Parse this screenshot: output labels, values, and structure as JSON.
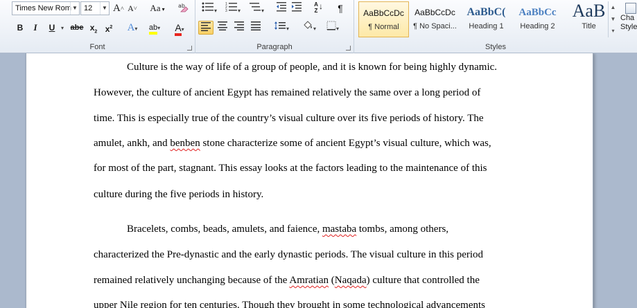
{
  "font": {
    "face_value": "Times New Rom",
    "size_value": "12",
    "grow_label": "A",
    "shrink_label": "A",
    "case_label": "Aa",
    "bold": "B",
    "italic": "I",
    "underline": "U",
    "strike": "abe",
    "subscript": "x",
    "superscript": "x",
    "effects": "A",
    "highlight": "ab",
    "color": "A",
    "group_label": "Font"
  },
  "paragraph": {
    "sort": "A Z",
    "pilcrow": "¶",
    "group_label": "Paragraph"
  },
  "styles": {
    "items": [
      {
        "sample": "AaBbCcDc",
        "name": "¶ Normal"
      },
      {
        "sample": "AaBbCcDc",
        "name": "¶ No Spaci..."
      },
      {
        "sample": "AaBbC(",
        "name": "Heading 1"
      },
      {
        "sample": "AaBbCc",
        "name": "Heading 2"
      },
      {
        "sample": "AaB",
        "name": "Title"
      }
    ],
    "change_label": "Cha Style",
    "group_label": "Styles"
  },
  "document": {
    "p1": [
      "Culture is the way of life of a group of people, and it is known for being highly dynamic.",
      "However, the culture of ancient Egypt has remained relatively the same over a long period of",
      "time. This is especially true of the country’s visual culture over its five periods of history. The",
      [
        "amulet, ankh, and ",
        "benben",
        " stone characterize some of ancient Egypt’s visual culture, which was,"
      ],
      "for most of the part, stagnant. This essay looks at the factors leading to the maintenance of this",
      "culture during the five periods in history."
    ],
    "p2": [
      [
        "Bracelets, combs, beads, amulets, and faience, ",
        "mastaba",
        " tombs, among others,"
      ],
      "characterized the Pre-dynastic and the early dynastic periods. The visual culture in this period",
      [
        "remained relatively unchanging because of the ",
        "Amratian",
        " (",
        "Naqada",
        ") culture that controlled the"
      ],
      "upper Nile region for ten centuries. Though they brought in some technological advancements"
    ]
  }
}
